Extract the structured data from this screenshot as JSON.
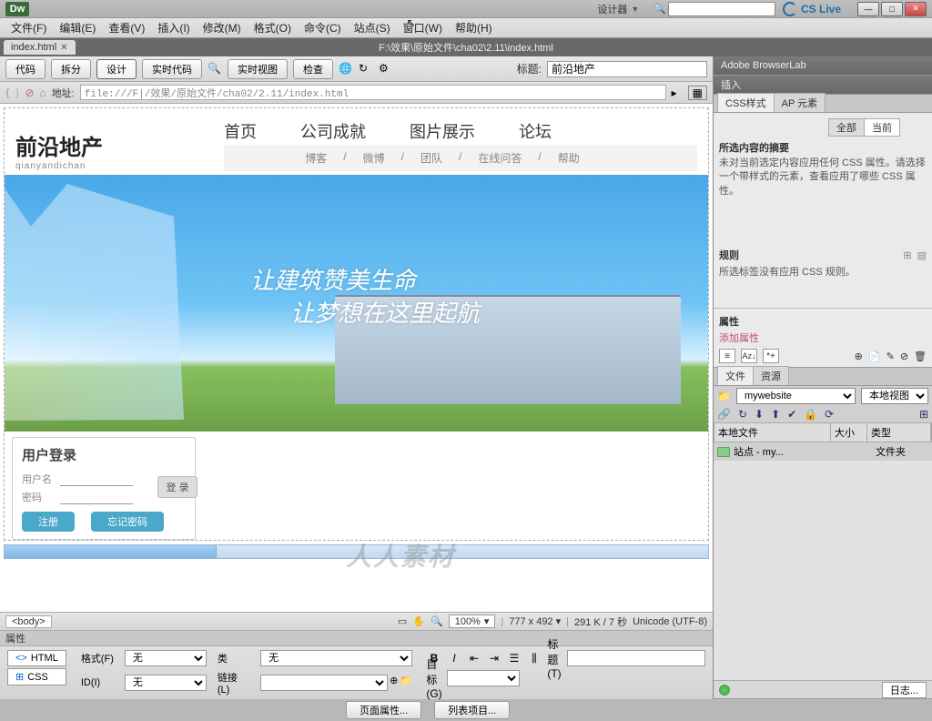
{
  "chrome": {
    "badge": "Dw",
    "designer": "设计器",
    "cslive": "CS Live"
  },
  "menu": [
    "文件(F)",
    "编辑(E)",
    "查看(V)",
    "插入(I)",
    "修改(M)",
    "格式(O)",
    "命令(C)",
    "站点(S)",
    "窗口(W)",
    "帮助(H)"
  ],
  "doc": {
    "tab": "index.html",
    "path": "F:\\效果\\原始文件\\cha02\\2.11\\index.html"
  },
  "toolbar": {
    "code": "代码",
    "split": "拆分",
    "design": "设计",
    "live_code": "实时代码",
    "live_view": "实时视图",
    "check": "检查",
    "title_label": "标题:",
    "title_value": "前沿地产"
  },
  "addrbar": {
    "label": "地址:",
    "value": "file:///F|/效果/原始文件/cha02/2.11/index.html"
  },
  "page": {
    "brand": "前沿地产",
    "brand_sub": "qianyandichan",
    "nav_main": [
      "首页",
      "公司成就",
      "图片展示",
      "论坛"
    ],
    "nav_sub": [
      "博客",
      "/",
      "微博",
      "/",
      "团队",
      "/",
      "在线问答",
      "/",
      "帮助"
    ],
    "slogan1": "让建筑赞美生命",
    "slogan2": "让梦想在这里起航",
    "login": {
      "title": "用户登录",
      "user_label": "用户名",
      "pass_label": "密码",
      "login_btn": "登 录",
      "register": "注册",
      "forgot": "忘记密码"
    }
  },
  "status": {
    "tag": "<body>",
    "zoom": "100%",
    "dims": "777 x 492",
    "size_time": "291 K / 7 秒",
    "encoding": "Unicode (UTF-8)"
  },
  "props": {
    "title": "属性",
    "html": "HTML",
    "css": "CSS",
    "format_label": "格式(F)",
    "format_val": "无",
    "id_label": "ID(I)",
    "id_val": "无",
    "class_label": "类",
    "class_val": "无",
    "link_label": "链接(L)",
    "title2_label": "标题(T)",
    "target_label": "目标(G)",
    "page_props": "页面属性...",
    "list_items": "列表项目..."
  },
  "right": {
    "browserlab": "Adobe BrowserLab",
    "insert": "插入",
    "css_tab": "CSS样式",
    "ap_tab": "AP 元素",
    "all": "全部",
    "current": "当前",
    "summary_title": "所选内容的摘要",
    "summary_text": "未对当前选定内容应用任何 CSS 属性。请选择一个带样式的元素，查看应用了哪些 CSS 属性。",
    "rules_title": "规则",
    "rules_text": "所选标签没有应用 CSS 规则。",
    "attrs_title": "属性",
    "add_attr": "添加属性",
    "files_tab": "文件",
    "assets_tab": "资源",
    "site_name": "mywebsite",
    "view": "本地视图",
    "col_file": "本地文件",
    "col_size": "大小",
    "col_type": "类型",
    "tree_item": "站点 - my...",
    "tree_type": "文件夹",
    "log_btn": "日志..."
  },
  "watermark": "人人素材"
}
